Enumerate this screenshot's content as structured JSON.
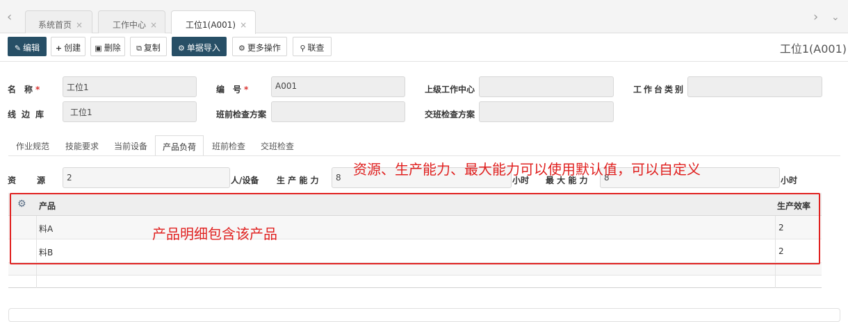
{
  "tabs": {
    "items": [
      {
        "label": "系统首页"
      },
      {
        "label": "工作中心"
      },
      {
        "label": "工位1(A001)"
      }
    ],
    "active_index": 2
  },
  "toolbar": {
    "edit": "编辑",
    "create": "创建",
    "delete": "删除",
    "copy": "复制",
    "import": "单据导入",
    "more": "更多操作",
    "lookup": "联查"
  },
  "page_title": "工位1(A001)",
  "form": {
    "name_label": "名　称",
    "name_value": "工位1",
    "code_label": "编　号",
    "code_value": "A001",
    "parent_label": "上级工作中心",
    "parent_value": "",
    "station_type_label": "工作台类别",
    "station_type_value": "",
    "line_store_label": "线边库",
    "line_store_value": "工位1",
    "pre_check_label": "班前检查方案",
    "pre_check_value": "",
    "handover_label": "交班检查方案",
    "handover_value": ""
  },
  "subtabs": [
    {
      "label": "作业规范"
    },
    {
      "label": "技能要求"
    },
    {
      "label": "当前设备"
    },
    {
      "label": "产品负荷"
    },
    {
      "label": "班前检查"
    },
    {
      "label": "交班检查"
    }
  ],
  "subtab_active_index": 3,
  "load": {
    "resource_label": "资　　源",
    "resource_value": "2",
    "resource_unit": "人/设备",
    "capacity_label": "生 产 能 力",
    "capacity_value": "8",
    "capacity_unit": "小时",
    "max_capacity_label": "最 大 能 力",
    "max_capacity_value": "8",
    "max_capacity_unit": "小时"
  },
  "grid": {
    "columns": [
      "产品",
      "生产效率"
    ],
    "rows": [
      {
        "product": "料A",
        "efficiency": "2"
      },
      {
        "product": "料B",
        "efficiency": "2"
      }
    ]
  },
  "annotations": {
    "top_note": "资源、生产能力、最大能力可以使用默认值，可以自定义",
    "grid_note": "产品明细包含该产品"
  },
  "colors": {
    "primary": "#274f66",
    "required": "#d9322f",
    "annotation": "#e0201f"
  }
}
